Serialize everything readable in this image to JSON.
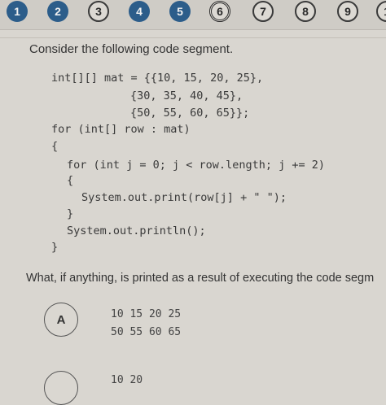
{
  "question_nav": [
    {
      "label": "1",
      "state": "filled"
    },
    {
      "label": "2",
      "state": "filled"
    },
    {
      "label": "3",
      "state": "open"
    },
    {
      "label": "4",
      "state": "filled"
    },
    {
      "label": "5",
      "state": "filled"
    },
    {
      "label": "6",
      "state": "current"
    },
    {
      "label": "7",
      "state": "open"
    },
    {
      "label": "8",
      "state": "open"
    },
    {
      "label": "9",
      "state": "open"
    },
    {
      "label": "1",
      "state": "open"
    }
  ],
  "prompt": "Consider the following code segment.",
  "code_lines": [
    "int[][] mat = {{10, 15, 20, 25},",
    "{30, 35, 40, 45},",
    "{50, 55, 60, 65}};",
    "for (int[] row : mat)",
    "{",
    "for (int j = 0; j < row.length; j += 2)",
    "{",
    "System.out.print(row[j] + \" \");",
    "}",
    "System.out.println();",
    "}"
  ],
  "question": "What, if anything, is printed as a result of executing the code segm",
  "choices": [
    {
      "letter": "A",
      "lines": [
        "10 15 20 25",
        "50 55 60 65"
      ]
    },
    {
      "letter": "",
      "lines": [
        "10 20"
      ]
    }
  ]
}
